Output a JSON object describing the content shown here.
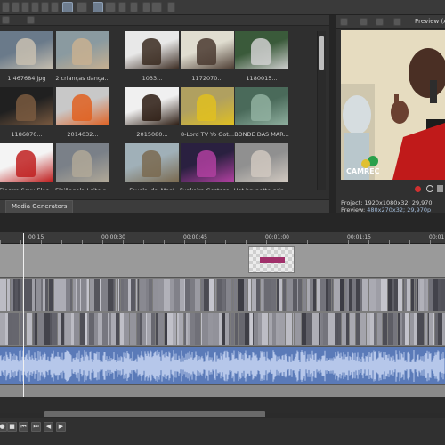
{
  "explorer": {
    "thumbnails": [
      {
        "caption": "1.467684.jpg"
      },
      {
        "caption": "2 crianças dança..."
      },
      {
        "caption": "1033..."
      },
      {
        "caption": "1172070..."
      },
      {
        "caption": "1180015..."
      },
      {
        "caption": "1186870..."
      },
      {
        "caption": "2014032..."
      },
      {
        "caption": "2015080..."
      },
      {
        "caption": "8-Lord TV Yo Got..."
      },
      {
        "caption": "BONDE DAS MAR..."
      },
      {
        "caption": "Electro Sexy Elec..."
      },
      {
        "caption": "Elsiângela-Leite-r..."
      },
      {
        "caption": "Favela_da_Maré"
      },
      {
        "caption": "Funkeira Gostosa..."
      },
      {
        "caption": "Hot brunette grin..."
      }
    ],
    "tab_label": "Media Generators"
  },
  "preview": {
    "title": "Preview (A",
    "project_label": "Project:",
    "project_value": "1920x1080x32; 29,970i",
    "preview_label": "Preview:",
    "preview_value": "480x270x32; 29,970p",
    "logo_text": "CAMREC"
  },
  "timeline": {
    "ticks": [
      "00:15",
      "00:00:30",
      "00:00:45",
      "00:01:00",
      "00:01:15",
      "00:01"
    ]
  },
  "colors": {
    "audio_track": "#5a7ab8",
    "background": "#2b2b2b",
    "record_button": "#d03030"
  },
  "icons": {
    "transport": [
      "record-icon",
      "play-icon",
      "stop-icon",
      "go-start-icon",
      "prev-frame-icon",
      "next-frame-icon"
    ]
  }
}
